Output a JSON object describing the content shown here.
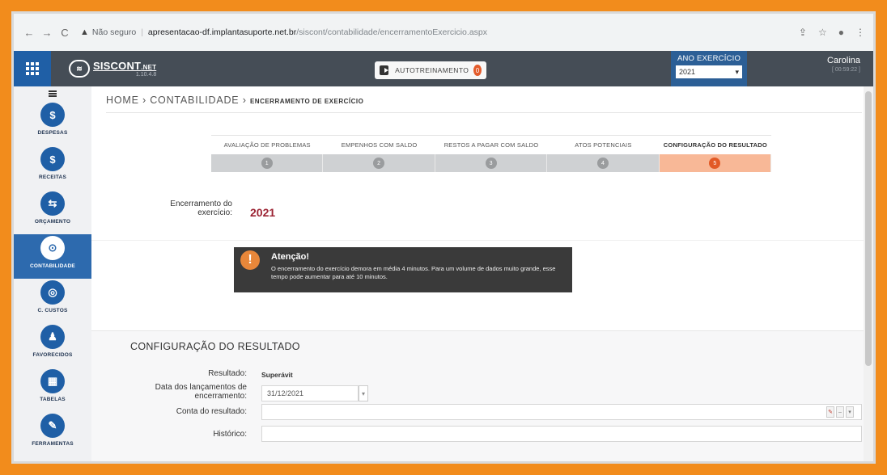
{
  "browser": {
    "insecure_label": "Não seguro",
    "host": "apresentacao-df.implantasuporte.net.br",
    "path": "/siscont/contabilidade/encerramentoExercicio.aspx"
  },
  "header": {
    "app_name": "SISCONT",
    "app_suffix": ".NET",
    "version": "1.10.4.8",
    "autotrain_label": "AUTOTREINAMENTO",
    "autotrain_badge": "0",
    "ano_label": "ANO EXERCÍCIO",
    "ano_value": "2021",
    "user_name": "Carolina",
    "user_time": "[ 00:59:22 ]"
  },
  "sidebar": {
    "items": [
      {
        "label": "DESPESAS",
        "glyph": "$"
      },
      {
        "label": "RECEITAS",
        "glyph": "$"
      },
      {
        "label": "ORÇAMENTO",
        "glyph": "⇆"
      },
      {
        "label": "CONTABILIDADE",
        "glyph": "⊙"
      },
      {
        "label": "C. CUSTOS",
        "glyph": "◎"
      },
      {
        "label": "FAVORECIDOS",
        "glyph": "♟"
      },
      {
        "label": "TABELAS",
        "glyph": "▦"
      },
      {
        "label": "FERRAMENTAS",
        "glyph": "✎"
      }
    ]
  },
  "breadcrumb": {
    "home": "HOME",
    "section": "CONTABILIDADE",
    "current": "ENCERRAMENTO DE EXERCÍCIO"
  },
  "steps": [
    {
      "label": "AVALIAÇÃO DE PROBLEMAS",
      "num": "1"
    },
    {
      "label": "EMPENHOS COM SALDO",
      "num": "2"
    },
    {
      "label": "RESTOS A PAGAR COM SALDO",
      "num": "3"
    },
    {
      "label": "ATOS POTENCIAIS",
      "num": "4"
    },
    {
      "label": "CONFIGURAÇÃO DO RESULTADO",
      "num": "5"
    }
  ],
  "encerramento": {
    "label": "Encerramento do exercício:",
    "year": "2021"
  },
  "alert": {
    "title": "Atenção!",
    "message": "O encerramento do exercício demora em média 4 minutos. Para um volume de dados muito grande, esse tempo pode aumentar para até 10 minutos."
  },
  "config": {
    "title": "CONFIGURAÇÃO DO RESULTADO",
    "resultado_label": "Resultado:",
    "resultado_value": "Superávit",
    "data_label": "Data dos lançamentos de encerramento:",
    "data_value": "31/12/2021",
    "conta_label": "Conta do resultado:",
    "conta_value": "",
    "historico_label": "Histórico:",
    "historico_value": ""
  }
}
